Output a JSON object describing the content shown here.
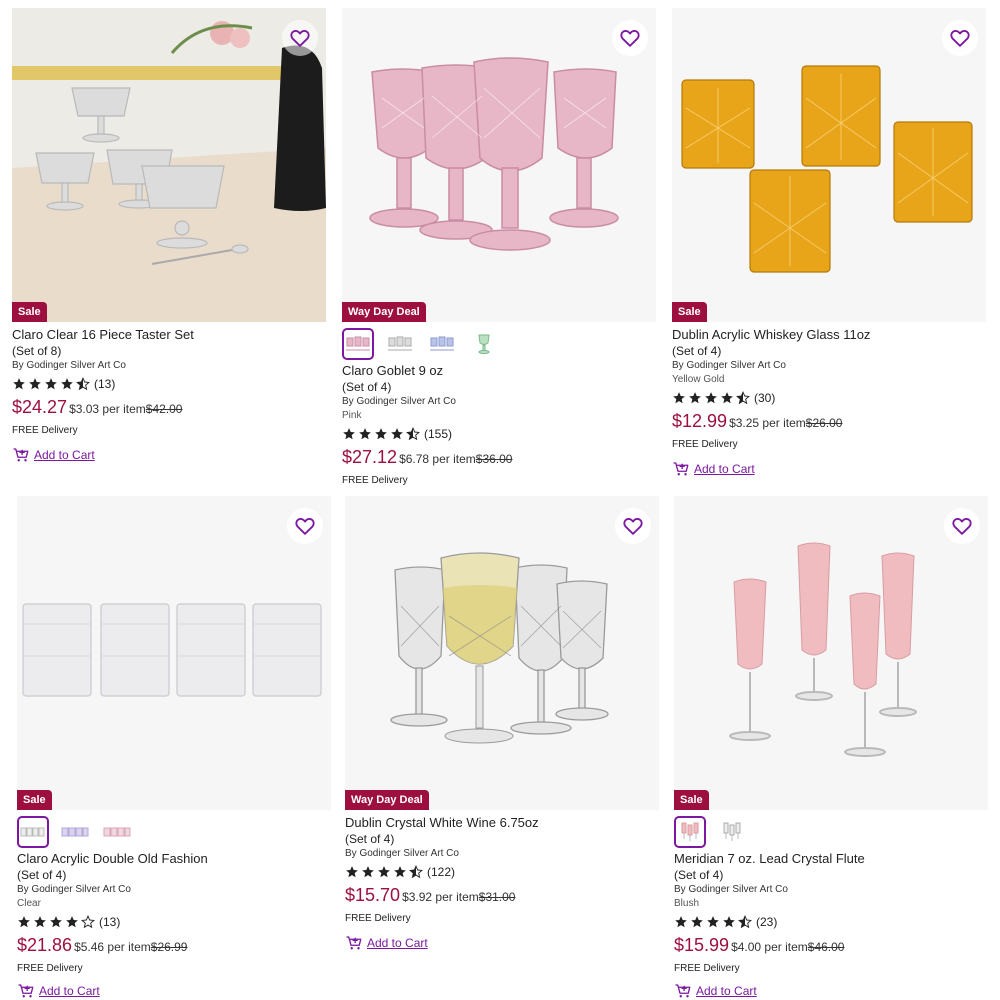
{
  "colors": {
    "accent": "#7b189f",
    "sale": "#9c0f3f",
    "price": "#9c0f3f"
  },
  "products": [
    {
      "badge": "Sale",
      "name": "Claro Clear 16 Piece Taster Set",
      "set": "(Set of 8)",
      "brand": "By Godinger Silver Art Co",
      "color": "",
      "rating": 4.5,
      "reviews": "(13)",
      "price": "$24.27",
      "per_item": "$3.03 per item",
      "was": "$42.00",
      "delivery": "FREE Delivery",
      "cart": "Add to Cart"
    },
    {
      "badge": "Way Day Deal",
      "name": "Claro Goblet 9 oz",
      "set": "(Set of 4)",
      "brand": "By Godinger Silver Art Co",
      "color": "Pink",
      "rating": 4.5,
      "reviews": "(155)",
      "price": "$27.12",
      "per_item": "$6.78 per item",
      "was": "$36.00",
      "delivery": "FREE Delivery",
      "cart": "Add to Cart"
    },
    {
      "badge": "Sale",
      "name": "Dublin Acrylic Whiskey Glass 11oz",
      "set": "(Set of 4)",
      "brand": "By Godinger Silver Art Co",
      "color": "Yellow Gold",
      "rating": 4.5,
      "reviews": "(30)",
      "price": "$12.99",
      "per_item": "$3.25 per item",
      "was": "$26.00",
      "delivery": "FREE Delivery",
      "cart": "Add to Cart"
    },
    {
      "badge": "Sale",
      "name": "Claro Acrylic Double Old Fashion",
      "set": "(Set of 4)",
      "brand": "By Godinger Silver Art Co",
      "color": "Clear",
      "rating": 4,
      "reviews": "(13)",
      "price": "$21.86",
      "per_item": "$5.46 per item",
      "was": "$26.99",
      "delivery": "FREE Delivery",
      "cart": "Add to Cart"
    },
    {
      "badge": "Way Day Deal",
      "name": "Dublin Crystal White Wine 6.75oz",
      "set": "(Set of 4)",
      "brand": "By Godinger Silver Art Co",
      "color": "",
      "rating": 4.5,
      "reviews": "(122)",
      "price": "$15.70",
      "per_item": "$3.92 per item",
      "was": "$31.00",
      "delivery": "FREE Delivery",
      "cart": "Add to Cart"
    },
    {
      "badge": "Sale",
      "name": "Meridian 7 oz. Lead Crystal Flute",
      "set": "(Set of 4)",
      "brand": "By Godinger Silver Art Co",
      "color": "Blush",
      "rating": 4.5,
      "reviews": "(23)",
      "price": "$15.99",
      "per_item": "$4.00 per item",
      "was": "$46.00",
      "delivery": "FREE Delivery",
      "cart": "Add to Cart"
    }
  ]
}
